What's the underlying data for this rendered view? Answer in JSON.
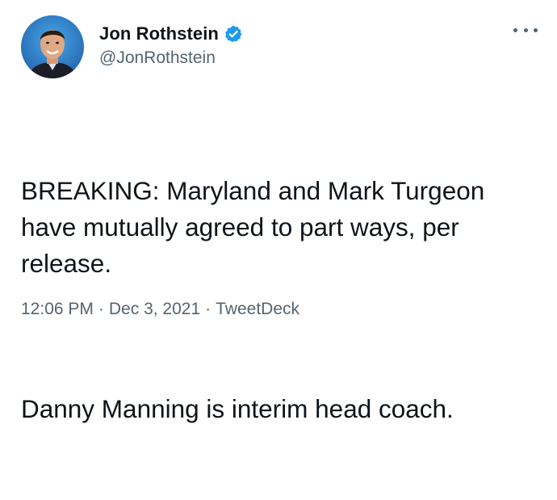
{
  "author": {
    "display_name": "Jon Rothstein",
    "handle": "@JonRothstein",
    "verified": true,
    "avatar_icon": "profile-photo"
  },
  "tweet": {
    "paragraphs": [
      "BREAKING: Maryland and Mark Turgeon have mutually agreed to part ways, per release.",
      "Danny Manning is interim head coach."
    ]
  },
  "meta": {
    "time": "12:06 PM",
    "date": "Dec 3, 2021",
    "source": "TweetDeck",
    "separator": "·"
  },
  "colors": {
    "text": "#0f1419",
    "secondary": "#536471",
    "verified": "#1d9bf0",
    "background": "#ffffff"
  },
  "icons": {
    "more": "more-options-icon",
    "verified": "verified-badge-icon"
  }
}
